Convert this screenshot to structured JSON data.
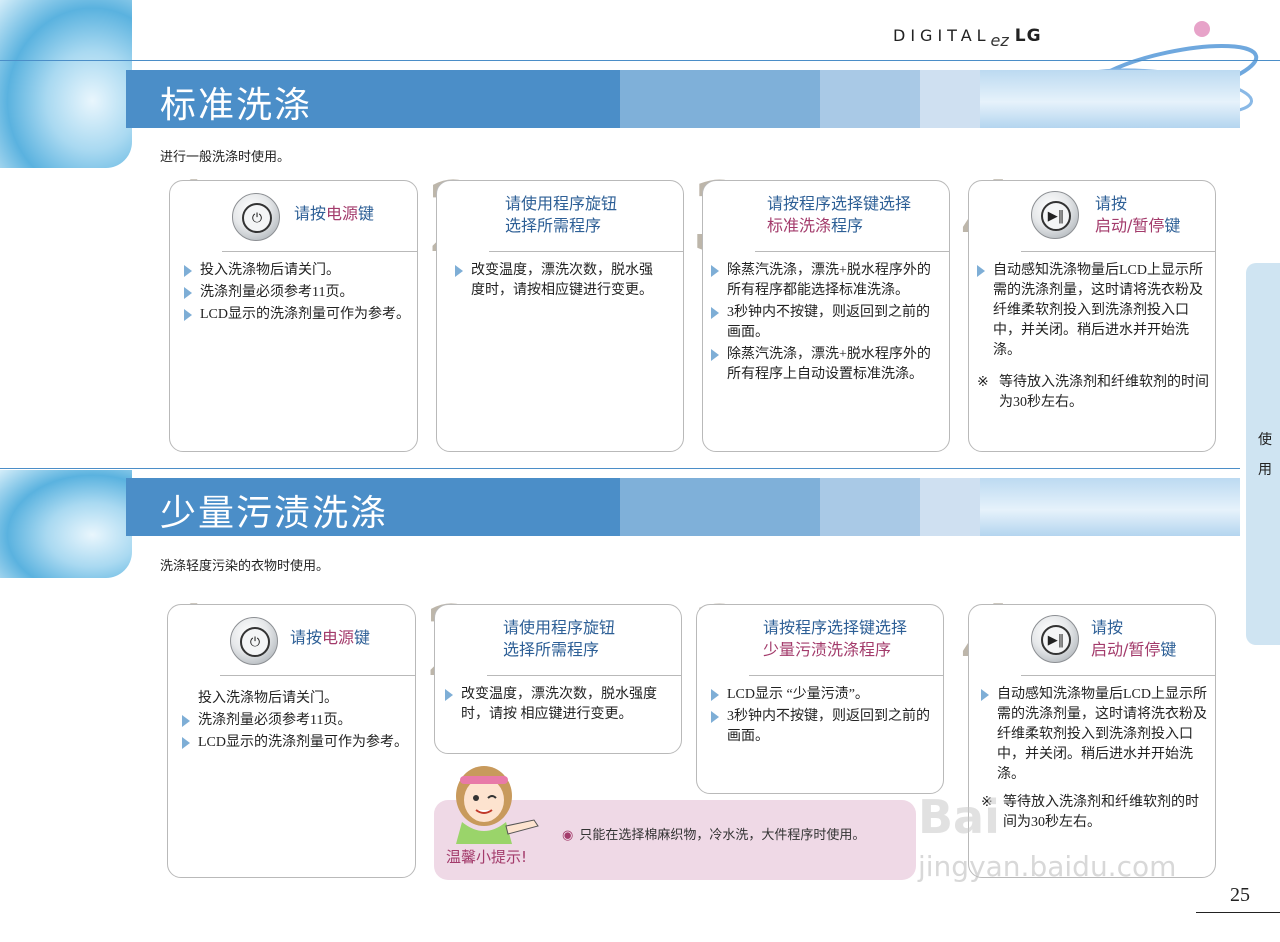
{
  "brand": {
    "digital": "DIGITAL",
    "ez": "ez",
    "lg": "LG"
  },
  "colors": {
    "bar": "#4b8ec8",
    "heading": "#2d5f96",
    "highlight": "#a33b6b",
    "number": "#bdb6aa"
  },
  "section1": {
    "title": "标准洗涤",
    "intro": "进行一般洗涤时使用。",
    "steps": [
      {
        "num": "1",
        "head_a": "请按",
        "head_hl": "电源",
        "head_b": "键",
        "icon": "power-button-icon",
        "items": [
          "投入洗涤物后请关门。",
          "洗涤剂量必须参考11页。",
          "LCD显示的洗涤剂量可作为参考。"
        ]
      },
      {
        "num": "2",
        "head_line1": "请使用程序旋钮",
        "head_line2": "选择所需程序",
        "items": [
          "改变温度，漂洗次数，脱水强度时，请按相应键进行变更。"
        ]
      },
      {
        "num": "3",
        "head_line1": "请按程序选择键选择",
        "head_line2": "标准洗涤",
        "head_line2_b": "程序",
        "items": [
          "除蒸汽洗涤，漂洗+脱水程序外的所有程序都能选择标准洗涤。",
          "3秒钟内不按键，则返回到之前的画面。",
          "除蒸汽洗涤，漂洗+脱水程序外的所有程序上自动设置标准洗涤。"
        ]
      },
      {
        "num": "4",
        "head_line1": "请按",
        "head_line2": "启动/暂停",
        "head_line2_b": "键",
        "icon": "play-pause-button-icon",
        "items": [
          "自动感知洗涤物量后LCD上显示所需的洗涤剂量，这时请将洗衣粉及纤维柔软剂投入到洗涤剂投入口中，并关闭。稍后进水并开始洗涤。"
        ],
        "note_mark": "※",
        "note": "等待放入洗涤剂和纤维软剂的时间为30秒左右。"
      }
    ]
  },
  "section2": {
    "title": "少量污渍洗涤",
    "intro": "洗涤轻度污染的衣物时使用。",
    "steps": [
      {
        "num": "1",
        "head_a": "请按",
        "head_hl": "电源",
        "head_b": "键",
        "icon": "power-button-icon",
        "plain": "投入洗涤物后请关门。",
        "items": [
          "洗涤剂量必须参考11页。",
          "LCD显示的洗涤剂量可作为参考。"
        ]
      },
      {
        "num": "2",
        "head_line1": "请使用程序旋钮",
        "head_line2": "选择所需程序",
        "items": [
          "改变温度，漂洗次数，脱水强度时，请按 相应键进行变更。"
        ]
      },
      {
        "num": "3",
        "head_line1": "请按程序选择键选择",
        "head_line2": "少量污渍洗涤程序",
        "items": [
          "LCD显示 “少量污渍”。",
          "3秒钟内不按键，则返回到之前的画面。"
        ]
      },
      {
        "num": "4",
        "head_line1": "请按",
        "head_line2": "启动/暂停",
        "head_line2_b": "键",
        "icon": "play-pause-button-icon",
        "items": [
          "自动感知洗涤物量后LCD上显示所需的洗涤剂量，这时请将洗衣粉及纤维柔软剂投入到洗涤剂投入口中，并关闭。稍后进水并开始洗涤。"
        ],
        "note_mark": "※",
        "note": "等待放入洗涤剂和纤维软剂的时间为30秒左右。"
      }
    ],
    "tip": {
      "title": "温馨小提示!",
      "bullet": "◉",
      "text": "只能在选择棉麻织物，冷水洗，大件程序时使用。"
    }
  },
  "side_tab": [
    "使",
    "用"
  ],
  "page_number": "25",
  "watermark": {
    "line1": "Bai",
    "line2": "jingyan.baidu.com"
  }
}
